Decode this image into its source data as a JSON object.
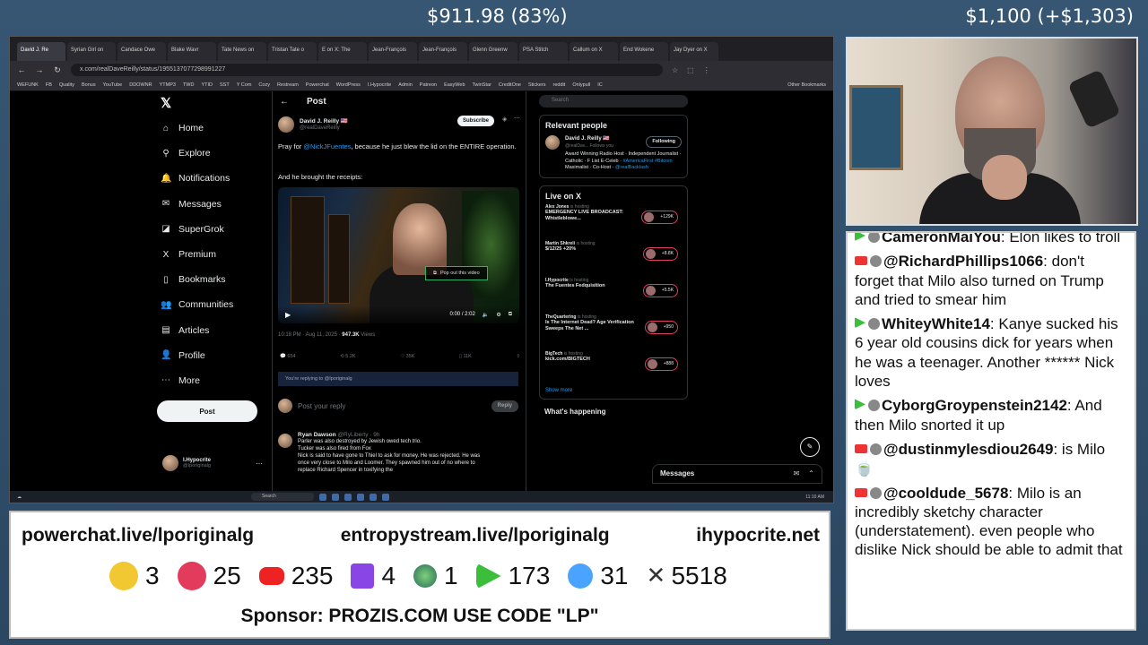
{
  "overlay": {
    "amount_center": "$911.98 (83%)",
    "amount_right": "$1,100 (+$1,303)"
  },
  "browser": {
    "tabs": [
      "David J. Re",
      "Syrian Girl on",
      "Candace Owe",
      "Blake Wavr",
      "Tate News on",
      "Tristan Tate o",
      "E on X: The",
      "Jean-François",
      "Jean-François",
      "Glenn Greenw",
      "PSA Stitch",
      "Callum on X",
      "End Wokene",
      "Jay Dyer on X"
    ],
    "url": "x.com/realDaveReilly/status/1955137077298991227",
    "bookmarks": [
      "WEFUNK",
      "FB",
      "Quality",
      "Bonus",
      "YouTube",
      "DDOWNR",
      "YTMP3",
      "TWD",
      "YTID",
      "SST",
      "Y Com",
      "Cozy",
      "Restream",
      "Powerchat",
      "WordPress",
      "I.Hypocrite",
      "Admin",
      "Patreon",
      "EasyWeb",
      "TwinStar",
      "CreditOne",
      "Stickers",
      "reddit",
      "Onlypull",
      "IC"
    ],
    "other_bookmarks": "Other Bookmarks"
  },
  "sidebar": {
    "items": [
      {
        "icon": "home-icon",
        "glyph": "⌂",
        "label": "Home"
      },
      {
        "icon": "search-icon",
        "glyph": "⚲",
        "label": "Explore"
      },
      {
        "icon": "bell-icon",
        "glyph": "🔔",
        "label": "Notifications"
      },
      {
        "icon": "mail-icon",
        "glyph": "✉",
        "label": "Messages"
      },
      {
        "icon": "grok-icon",
        "glyph": "◪",
        "label": "SuperGrok"
      },
      {
        "icon": "x-icon",
        "glyph": "X",
        "label": "Premium"
      },
      {
        "icon": "bookmark-icon",
        "glyph": "▯",
        "label": "Bookmarks"
      },
      {
        "icon": "communities-icon",
        "glyph": "👥",
        "label": "Communities"
      },
      {
        "icon": "articles-icon",
        "glyph": "▤",
        "label": "Articles"
      },
      {
        "icon": "profile-icon",
        "glyph": "👤",
        "label": "Profile"
      },
      {
        "icon": "more-icon",
        "glyph": "⋯",
        "label": "More"
      }
    ],
    "post_label": "Post",
    "account_name": "I.Hypocrite",
    "account_handle": "@Iporiginalg"
  },
  "post": {
    "header": "Post",
    "author_name": "David J. Reilly 🇺🇸",
    "author_handle": "@realDaveReilly",
    "subscribe_label": "Subscribe",
    "text_before": "Pray for ",
    "text_mention": "@NickJFuentes",
    "text_after": ", because he just blew the lid on the ENTIRE operation.",
    "text2": "And he brought the receipts:",
    "popout_label": "Pop out this video",
    "video_time": "0:00 / 2:02",
    "timestamp": "10:18 PM · Aug 11, 2025 · ",
    "views": "947.3K",
    "views_label": " Views",
    "actions": {
      "replies": "654",
      "reposts": "5.2K",
      "likes": "35K",
      "bookmarks": "11K"
    },
    "replying_to": "You're replying to @Iporiginalg",
    "reply_placeholder": "Post your reply",
    "reply_button": "Reply"
  },
  "reply": {
    "name": "Ryan Dawson",
    "handle": "@RyLiberty · 9h",
    "lines": [
      "Parler was also destroyed by Jewish owed tech trio.",
      "Tucker was also fired from Fox",
      "Nick is said to have gone to Thiel to ask for money. He was rejected. He was",
      "once very close to Milo and Loomer. They spawned him out of no where to",
      "replace Richard Spencer in toxifying the"
    ]
  },
  "right": {
    "search_placeholder": "Search",
    "relevant_title": "Relevant people",
    "rp_name": "David J. Reilly 🇺🇸",
    "rp_handle": "@realDav... Follows you",
    "following_label": "Following",
    "rp_bio_1": "Award Winning Radio Host · Independent Journalist · Catholic · F List E-Celeb · ",
    "rp_bio_tag1": "#AmericaFirst",
    "rp_bio_tag2": "#Bitcoin",
    "rp_bio_2": " Maximalist · Co-Host · ",
    "rp_bio_tag3": "@realBacklash",
    "live_title": "Live on X",
    "live": [
      {
        "host": "Alex Jones",
        "status": " is hosting",
        "title": "EMERGENCY LIVE BROADCAST: Whistleblowe...",
        "count": "+129K"
      },
      {
        "host": "Martin Shkreli",
        "status": " is hosting",
        "title": "$/12/25 +20%",
        "count": "+8.8K"
      },
      {
        "host": "I.Hypocrite",
        "status": " is hosting",
        "title": "The Fuentes Fedquisition",
        "count": "+5.5K"
      },
      {
        "host": "TheQuartering",
        "status": " is hosting",
        "title": "Is The Internet Dead? Age Verification Sweeps The Net ...",
        "count": "+950"
      },
      {
        "host": "BigTech",
        "status": " is hosting",
        "title": "kick.com/BIGTECH",
        "count": "+888"
      }
    ],
    "show_more": "Show more",
    "whats_happening": "What's happening",
    "messages": "Messages"
  },
  "taskbar": {
    "search": "Search",
    "clock": "11:10 AM"
  },
  "chat": {
    "messages": [
      {
        "platform": "rm",
        "user": "CameronMaiYou",
        "text": "Elon likes to troll"
      },
      {
        "platform": "yt",
        "user": "@RichardPhillips1066",
        "text": "don't forget that Milo also turned on Trump and tried to smear him"
      },
      {
        "platform": "rm",
        "user": "WhiteyWhite14",
        "text": "Kanye sucked his 6 year old cousins dick for years when he was a teenager. Another ****** Nick loves"
      },
      {
        "platform": "rm",
        "user": "CyborgGroypenstein2142",
        "text": "And then Milo snorted it up"
      },
      {
        "platform": "yt",
        "user": "@dustinmylesdiou2649",
        "text": "is Milo 🍵"
      },
      {
        "platform": "yt",
        "user": "@cooldude_5678",
        "text": "Milo is an incredibly sketchy character (understatement). even people who dislike Nick should be able to admit that"
      }
    ]
  },
  "bottom": {
    "link1": "powerchat.live/lporiginalg",
    "link2": "entropystream.live/lporiginalg",
    "link3": "ihypocrite.net",
    "counters": [
      {
        "icon": "kick-icon",
        "cls": "c-kick",
        "value": "3"
      },
      {
        "icon": "powerchat-icon",
        "cls": "c-pc",
        "value": "25"
      },
      {
        "icon": "youtube-icon",
        "cls": "c-yt",
        "value": "235"
      },
      {
        "icon": "twitch-icon",
        "cls": "c-tw",
        "value": "4"
      },
      {
        "icon": "gem-icon",
        "cls": "c-gem",
        "value": "1"
      },
      {
        "icon": "rumble-icon",
        "cls": "c-rum",
        "value": "173"
      },
      {
        "icon": "moon-icon",
        "cls": "c-moon",
        "value": "31"
      },
      {
        "icon": "x-icon",
        "cls": "c-x",
        "value": "5518"
      }
    ],
    "sponsor": "Sponsor: PROZIS.COM USE CODE \"LP\""
  }
}
